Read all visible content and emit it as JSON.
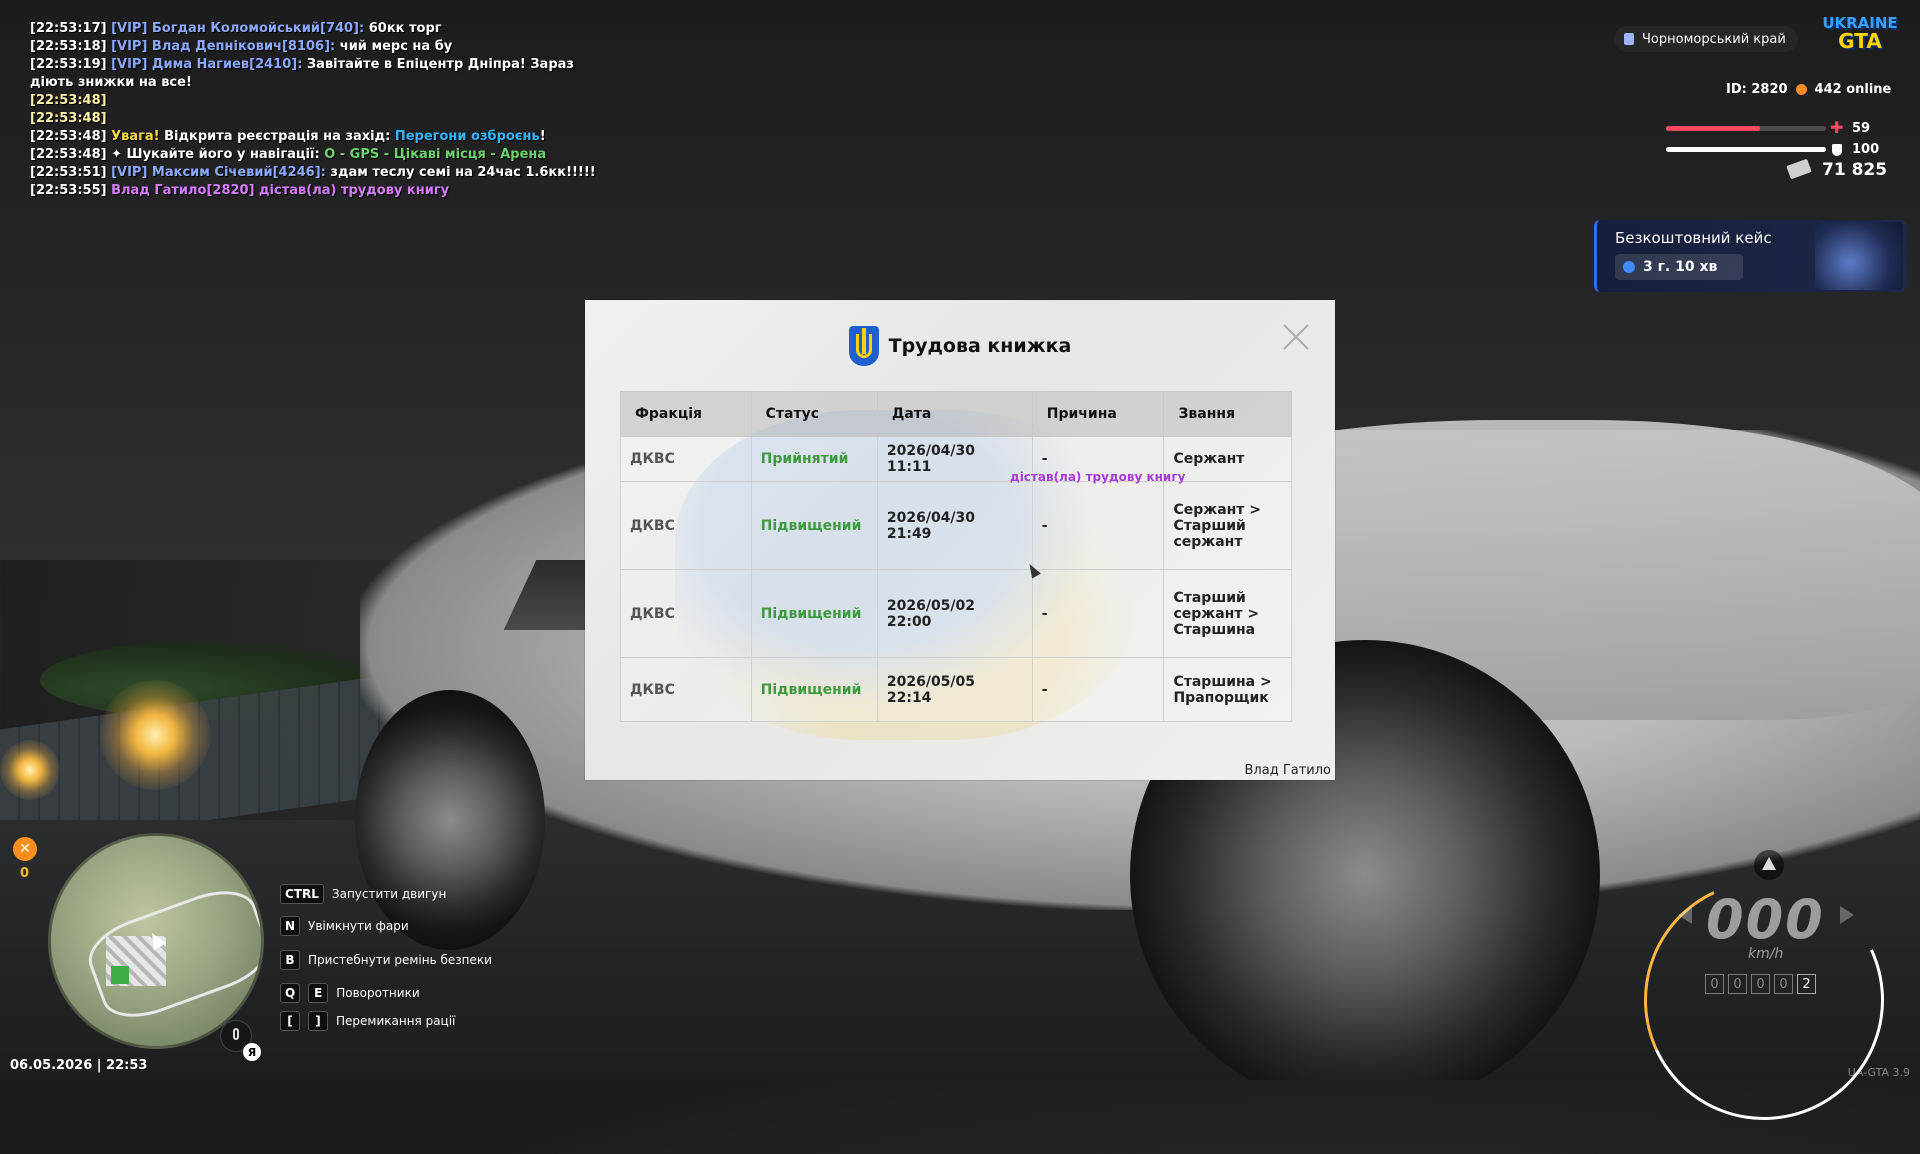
{
  "chat": [
    {
      "ts": "[22:53:17]",
      "parts": [
        {
          "c": "vip",
          "t": " [VIP] Богдан Коломойський[740]:"
        },
        {
          "c": "",
          "t": " 60кк торг"
        }
      ]
    },
    {
      "ts": "[22:53:18]",
      "parts": [
        {
          "c": "vip",
          "t": " [VIP] Влад Депнікович[8106]:"
        },
        {
          "c": "",
          "t": " чий мерс на бу"
        }
      ]
    },
    {
      "ts": "[22:53:19]",
      "parts": [
        {
          "c": "vip",
          "t": " [VIP] Дима Нагиев[2410]:"
        },
        {
          "c": "",
          "t": " Завітайте в Епіцентр Дніпра! Зараз діють знижки на все!"
        }
      ]
    },
    {
      "ts": "[22:53:48]",
      "tsClass": "tsy",
      "parts": []
    },
    {
      "ts": "[22:53:48]",
      "tsClass": "tsy",
      "parts": []
    },
    {
      "ts": "[22:53:48]",
      "parts": [
        {
          "c": "warn",
          "t": " Увага!"
        },
        {
          "c": "",
          "t": " Відкрита реєстрація на захід: "
        },
        {
          "c": "blue",
          "t": "Перегони озброєнь"
        },
        {
          "c": "",
          "t": "!"
        }
      ]
    },
    {
      "ts": "[22:53:48]",
      "parts": [
        {
          "c": "",
          "t": " ✦  Шукайте його у навігації: "
        },
        {
          "c": "green",
          "t": "O - GPS - Цікаві місця - Арена"
        }
      ]
    },
    {
      "ts": "[22:53:51]",
      "parts": [
        {
          "c": "vip",
          "t": " [VIP] Максим Січевий[4246]:"
        },
        {
          "c": "",
          "t": " здам теслу семі на 24час 1.6кк!!!!!"
        }
      ]
    },
    {
      "ts": "[22:53:55]",
      "parts": [
        {
          "c": "purple",
          "t": " Влад Гатило[2820] дістав(ла) трудову книгу"
        }
      ]
    }
  ],
  "hud": {
    "region": "Чорноморський край",
    "logo_line1": "UKRAINE",
    "logo_line2": "GTA",
    "id_label": "ID: 2820",
    "online_label": "442 online",
    "health": 59,
    "armor": 100,
    "money": "71 825",
    "case_title": "Безкоштовний кейс",
    "case_time": "3 г. 10 хв"
  },
  "modal": {
    "title": "Трудова книжка",
    "headers": [
      "Фракція",
      "Статус",
      "Дата",
      "Причина",
      "Звання"
    ],
    "rows": [
      [
        "ДКВС",
        "Прийнятий",
        "2026/04/30 11:11",
        "-",
        "Сержант"
      ],
      [
        "ДКВС",
        "Підвищений",
        "2026/04/30 21:49",
        "-",
        "Сержант > Старший сержант"
      ],
      [
        "ДКВС",
        "Підвищений",
        "2026/05/02 22:00",
        "-",
        "Старший сержант > Старшина"
      ],
      [
        "ДКВС",
        "Підвищений",
        "2026/05/05 22:14",
        "-",
        "Старшина > Прапорщик"
      ]
    ],
    "overlay_text": "дістав(ла) трудову книгу",
    "signature": "Влад Гатило"
  },
  "bottom": {
    "quest_count": "0",
    "datetime": "06.05.2026 | 22:53",
    "lang": "Я",
    "hints": [
      {
        "keys": [
          "CTRL"
        ],
        "label": "Запустити двигун"
      },
      {
        "keys": [
          "N"
        ],
        "label": "Увімкнути фари"
      },
      {
        "keys": [
          "B"
        ],
        "label": "Пристебнути ремінь безпеки"
      },
      {
        "keys": [
          "Q",
          "E"
        ],
        "label": "Поворотники"
      },
      {
        "keys": [
          "[",
          "]"
        ],
        "label": "Перемикання рації"
      }
    ]
  },
  "speedometer": {
    "speed": "000",
    "unit": "km/h",
    "odometer": [
      "0",
      "0",
      "0",
      "0",
      "2"
    ],
    "version": "UA-GTA 3.9"
  },
  "colors": {
    "vip": "#8ba8ff",
    "health": "#ff4860",
    "armor": "#ffffff",
    "promoted": "#3e9a3e",
    "accent": "#2f6bff"
  }
}
